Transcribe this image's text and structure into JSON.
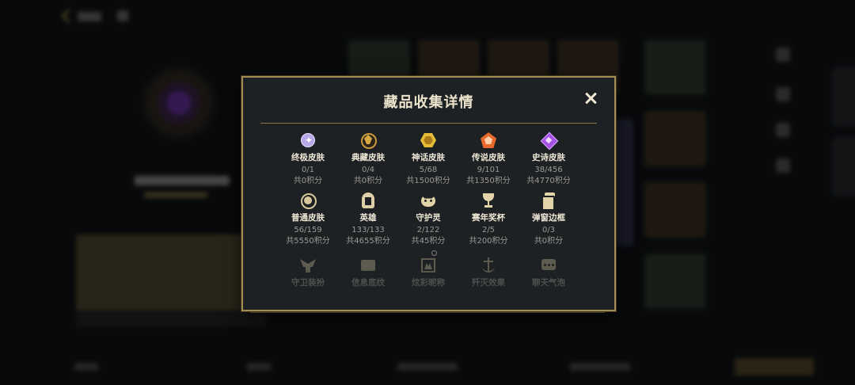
{
  "modal": {
    "title": "藏品收集详情",
    "close_label": "×"
  },
  "items": [
    {
      "icon": "ultimate-skin-icon",
      "label": "终极皮肤",
      "count": "0/1",
      "points": "共0积分",
      "color": "#c9b8f0"
    },
    {
      "icon": "prestige-skin-icon",
      "label": "典藏皮肤",
      "count": "0/4",
      "points": "共0积分",
      "color": "#c79a3a"
    },
    {
      "icon": "mythic-skin-icon",
      "label": "神话皮肤",
      "count": "5/68",
      "points": "共1500积分",
      "color": "#e0b83a"
    },
    {
      "icon": "legendary-skin-icon",
      "label": "传说皮肤",
      "count": "9/101",
      "points": "共1350积分",
      "color": "#e0632a"
    },
    {
      "icon": "epic-skin-icon",
      "label": "史诗皮肤",
      "count": "38/456",
      "points": "共4770积分",
      "color": "#a450e0"
    },
    {
      "icon": "standard-skin-icon",
      "label": "普通皮肤",
      "count": "56/159",
      "points": "共5550积分",
      "color": "#d8c79a"
    },
    {
      "icon": "champion-helmet-icon",
      "label": "英雄",
      "count": "133/133",
      "points": "共4655积分",
      "color": "#d8c79a"
    },
    {
      "icon": "ward-icon",
      "label": "守护灵",
      "count": "2/122",
      "points": "共45积分",
      "color": "#d8c79a"
    },
    {
      "icon": "trophy-icon",
      "label": "赛年奖杯",
      "count": "2/5",
      "points": "共200积分",
      "color": "#d8c79a"
    },
    {
      "icon": "popup-frame-icon",
      "label": "弹窗边框",
      "count": "0/3",
      "points": "共0积分",
      "color": "#d8c79a"
    },
    {
      "icon": "guardian-icon",
      "label": "守卫装扮",
      "count": "",
      "points": "",
      "color": "#d8c79a"
    },
    {
      "icon": "profile-frame-icon",
      "label": "信息底纹",
      "count": "",
      "points": "",
      "color": "#d8c79a"
    },
    {
      "icon": "stream-title-icon",
      "label": "炫彩昵称",
      "count": "",
      "points": "",
      "color": "#d8c79a"
    },
    {
      "icon": "anchor-effect-icon",
      "label": "歼灭效果",
      "count": "",
      "points": "",
      "color": "#d8c79a"
    },
    {
      "icon": "chat-bubble-icon",
      "label": "聊天气泡",
      "count": "",
      "points": "",
      "color": "#d8c79a"
    }
  ]
}
